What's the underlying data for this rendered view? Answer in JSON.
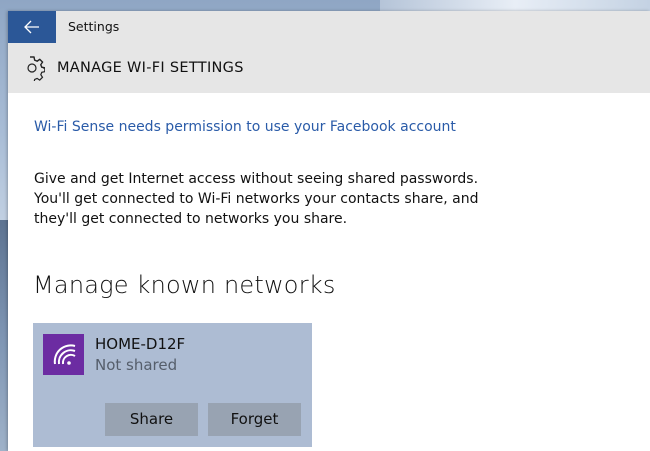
{
  "titlebar": {
    "back_icon": "arrow-left-icon",
    "title": "Settings"
  },
  "header": {
    "icon": "gear-icon",
    "title": "MANAGE WI-FI SETTINGS"
  },
  "permission_link": "Wi-Fi Sense needs permission to use your Facebook account",
  "description": "Give and get Internet access without seeing shared passwords. You'll get connected to Wi-Fi networks your contacts share, and they'll get connected to networks you share.",
  "known_networks": {
    "heading": "Manage known networks",
    "items": [
      {
        "icon": "wifi-icon",
        "name": "HOME-D12F",
        "status": "Not shared",
        "share_label": "Share",
        "forget_label": "Forget"
      }
    ]
  },
  "colors": {
    "accent": "#2b5797",
    "link": "#2a5ba8",
    "wifi_badge": "#6c2ca2",
    "tile_bg": "#adbcd3",
    "button_bg": "#98a3b2",
    "header_bg": "#e6e6e6"
  }
}
